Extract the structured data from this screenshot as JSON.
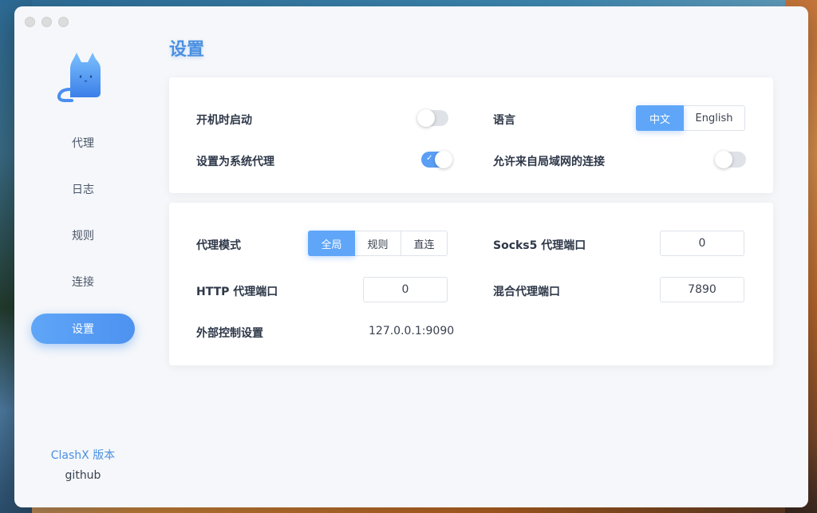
{
  "sidebar": {
    "items": [
      {
        "label": "代理"
      },
      {
        "label": "日志"
      },
      {
        "label": "规则"
      },
      {
        "label": "连接"
      },
      {
        "label": "设置",
        "active": true
      }
    ],
    "version_label": "ClashX 版本",
    "github_label": "github"
  },
  "page_title": "设置",
  "general": {
    "start_at_login": {
      "label": "开机时启动",
      "on": false
    },
    "set_system_proxy": {
      "label": "设置为系统代理",
      "on": true
    },
    "language": {
      "label": "语言",
      "options": [
        "中文",
        "English"
      ],
      "selected": "中文"
    },
    "allow_lan": {
      "label": "允许来自局域网的连接",
      "on": false
    }
  },
  "proxy": {
    "mode": {
      "label": "代理模式",
      "options": [
        "全局",
        "规则",
        "直连"
      ],
      "selected": "全局"
    },
    "socks5_port": {
      "label": "Socks5 代理端口",
      "value": "0"
    },
    "http_port": {
      "label": "HTTP 代理端口",
      "value": "0"
    },
    "mixed_port": {
      "label": "混合代理端口",
      "value": "7890"
    },
    "external_controller": {
      "label": "外部控制设置",
      "value": "127.0.0.1:9090"
    }
  },
  "colors": {
    "accent": "#5fa6f8",
    "title": "#4a90e2",
    "toggle_on": "#5a9ef5",
    "toggle_off": "#dfe3e8"
  }
}
